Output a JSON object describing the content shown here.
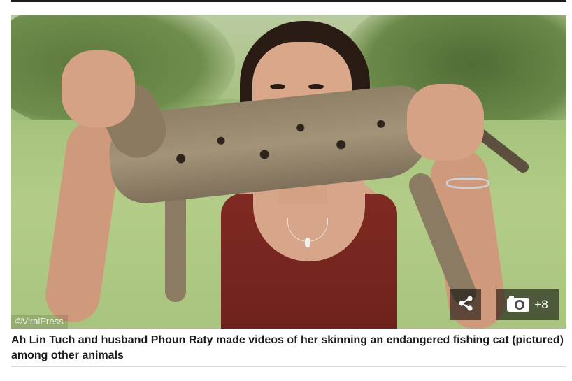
{
  "image": {
    "credit": "©ViralPress",
    "alt_subject": "woman holding pelt of a fishing cat"
  },
  "overlay": {
    "share_icon": "share-icon",
    "gallery_icon": "camera-icon",
    "gallery_count": "+8"
  },
  "caption": {
    "text": "Ah Lin Tuch and husband Phoun Raty made videos of her skinning an endangered fishing cat (pictured) among other animals"
  },
  "colors": {
    "caption_text": "#1b1b1b",
    "overlay_bg": "rgba(0,0,0,0.55)",
    "divider": "#d8d8d8"
  }
}
